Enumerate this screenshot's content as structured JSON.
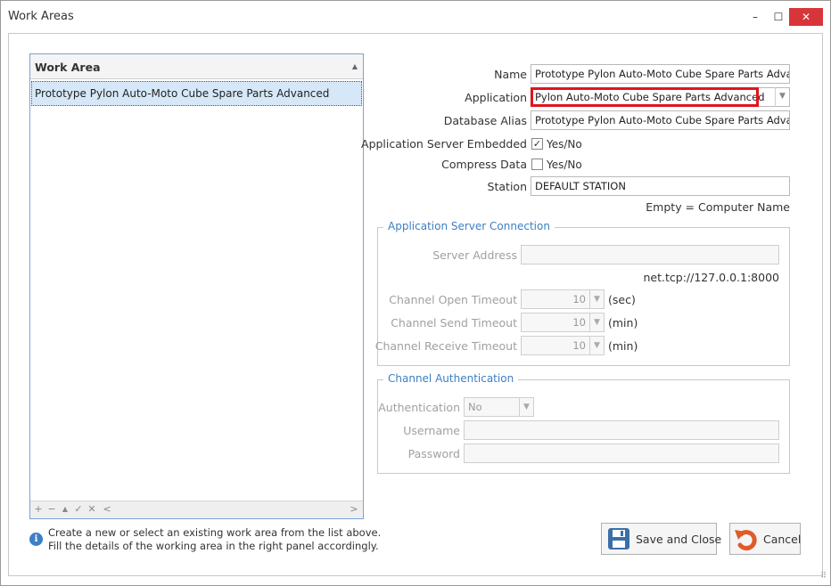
{
  "window": {
    "title": "Work Areas",
    "minimize_label": "–",
    "maximize_label": "☐",
    "close_label": "✕"
  },
  "list": {
    "header": "Work Area",
    "sort_glyph": "▲",
    "items": [
      {
        "label": "Prototype Pylon Auto-Moto Cube Spare Parts Advanced",
        "selected": true
      }
    ],
    "nav_buttons": [
      "+",
      "−",
      "▲",
      "✓",
      "✕",
      "<",
      ">"
    ]
  },
  "info": {
    "line1": "Create a new or select an existing work area from the list above.",
    "line2": "Fill the details of the working area in the right panel accordingly."
  },
  "form": {
    "name_label": "Name",
    "name_value": "Prototype Pylon Auto-Moto Cube Spare Parts Advanced",
    "application_label": "Application",
    "application_value": "Pylon Auto-Moto Cube Spare Parts Advanced",
    "db_alias_label": "Database Alias",
    "db_alias_value": "Prototype Pylon Auto-Moto Cube Spare Parts Advanced",
    "app_server_embedded_label": "Application Server Embedded",
    "app_server_embedded_checked": true,
    "app_server_embedded_option": "Yes/No",
    "compress_label": "Compress Data",
    "compress_checked": false,
    "compress_option": "Yes/No",
    "station_label": "Station",
    "station_value": "DEFAULT STATION",
    "station_hint": "Empty = Computer Name"
  },
  "server_group": {
    "title": "Application Server Connection",
    "address_label": "Server Address",
    "address_value": "",
    "address_hint": "net.tcp://127.0.0.1:8000",
    "open_label": "Channel Open Timeout",
    "open_value": "10",
    "open_unit": "(sec)",
    "send_label": "Channel Send Timeout",
    "send_value": "10",
    "send_unit": "(min)",
    "receive_label": "Channel Receive Timeout",
    "receive_value": "10",
    "receive_unit": "(min)"
  },
  "auth_group": {
    "title": "Channel Authentication",
    "auth_label": "Authentication",
    "auth_value": "No",
    "username_label": "Username",
    "username_value": "",
    "password_label": "Password",
    "password_value": ""
  },
  "buttons": {
    "save_label": "Save and Close",
    "cancel_label": "Cancel"
  },
  "colors": {
    "accent": "#3d7fc4",
    "close": "#d8353a",
    "highlight": "#e0141e",
    "cancel_icon": "#e05a2a",
    "save_icon": "#3a6fa8"
  }
}
